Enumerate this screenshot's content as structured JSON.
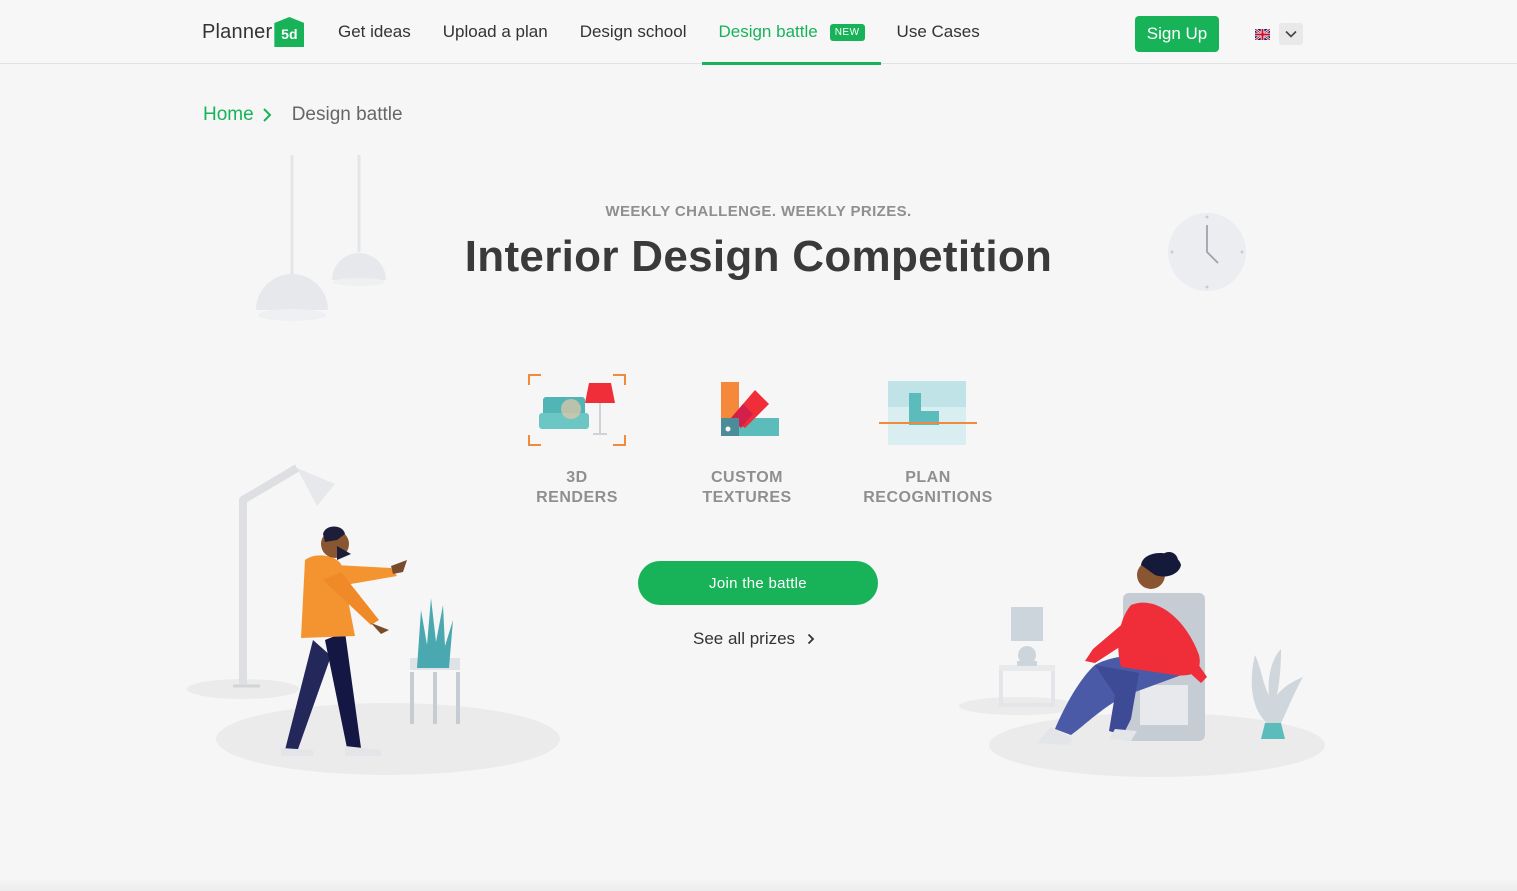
{
  "header": {
    "logo_text": "Planner",
    "logo_mark": "5d",
    "nav": [
      {
        "label": "Get ideas"
      },
      {
        "label": "Upload a plan"
      },
      {
        "label": "Design school"
      },
      {
        "label": "Design battle",
        "badge": "NEW",
        "active": true
      },
      {
        "label": "Use Cases"
      }
    ],
    "signup_label": "Sign Up",
    "language_icon": "uk-flag-icon"
  },
  "breadcrumb": {
    "home": "Home",
    "current": "Design battle"
  },
  "hero": {
    "eyebrow": "WEEKLY CHALLENGE. WEEKLY PRIZES.",
    "title": "Interior Design Competition"
  },
  "features": [
    {
      "label": "3D\nRENDERS",
      "icon": "3d-renders-icon"
    },
    {
      "label": "CUSTOM\nTEXTURES",
      "icon": "custom-textures-icon"
    },
    {
      "label": "PLAN\nRECOGNITIONS",
      "icon": "plan-recognition-icon"
    }
  ],
  "cta": {
    "join_label": "Join the battle",
    "prizes_label": "See all prizes"
  },
  "colors": {
    "accent": "#18b358",
    "background": "#f6f6f6",
    "text": "#333333",
    "muted": "#8f8f8f"
  }
}
